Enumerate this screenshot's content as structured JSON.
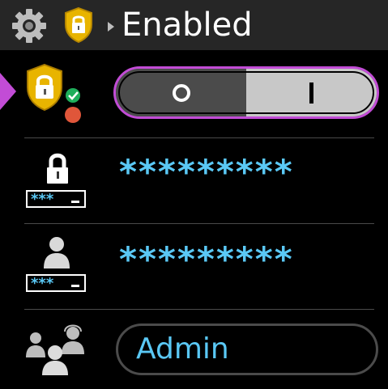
{
  "header": {
    "title": "Enabled",
    "icons": [
      "gear-icon",
      "shield-lock-icon",
      "arrow-right-icon"
    ]
  },
  "rows": {
    "security": {
      "icon": "shield-lock-status-icon",
      "toggle": {
        "off_label": "O",
        "on_label": "I",
        "selected": "I"
      }
    },
    "password": {
      "icon": "lock-password-icon",
      "icon_caption": "***_",
      "value": "*********"
    },
    "user_password": {
      "icon": "user-password-icon",
      "icon_caption": "***_",
      "value": "*********"
    },
    "role": {
      "icon": "users-group-icon",
      "value": "Admin"
    }
  },
  "colors": {
    "accent": "#c24cd6",
    "value_text": "#5ac8f5",
    "shield_gold": "#e8b400",
    "status_green": "#1fae5b",
    "status_red": "#e0563a"
  }
}
